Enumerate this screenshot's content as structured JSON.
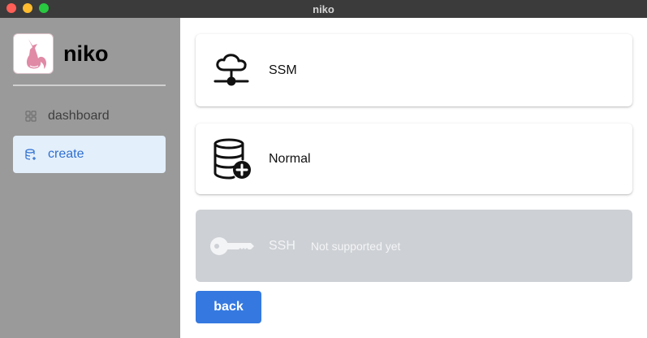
{
  "window": {
    "title": "niko"
  },
  "sidebar": {
    "brand": {
      "name": "niko",
      "logo_icon": "fox-logo-icon"
    },
    "items": [
      {
        "label": "dashboard",
        "icon": "grid-icon",
        "active": false
      },
      {
        "label": "create",
        "icon": "database-add-icon",
        "active": true
      }
    ]
  },
  "main": {
    "options": [
      {
        "label": "SSM",
        "icon": "cloud-network-icon",
        "enabled": true,
        "note": ""
      },
      {
        "label": "Normal",
        "icon": "database-plus-icon",
        "enabled": true,
        "note": ""
      },
      {
        "label": "SSH",
        "icon": "key-icon",
        "enabled": false,
        "note": "Not supported yet"
      }
    ],
    "back_label": "back"
  },
  "colors": {
    "accent": "#3579e0",
    "active_nav_bg": "#e3effb",
    "sidebar_bg": "#9a9a9a",
    "disabled_card_bg": "#cdd0d4",
    "logo_pink": "#e08aa6"
  }
}
